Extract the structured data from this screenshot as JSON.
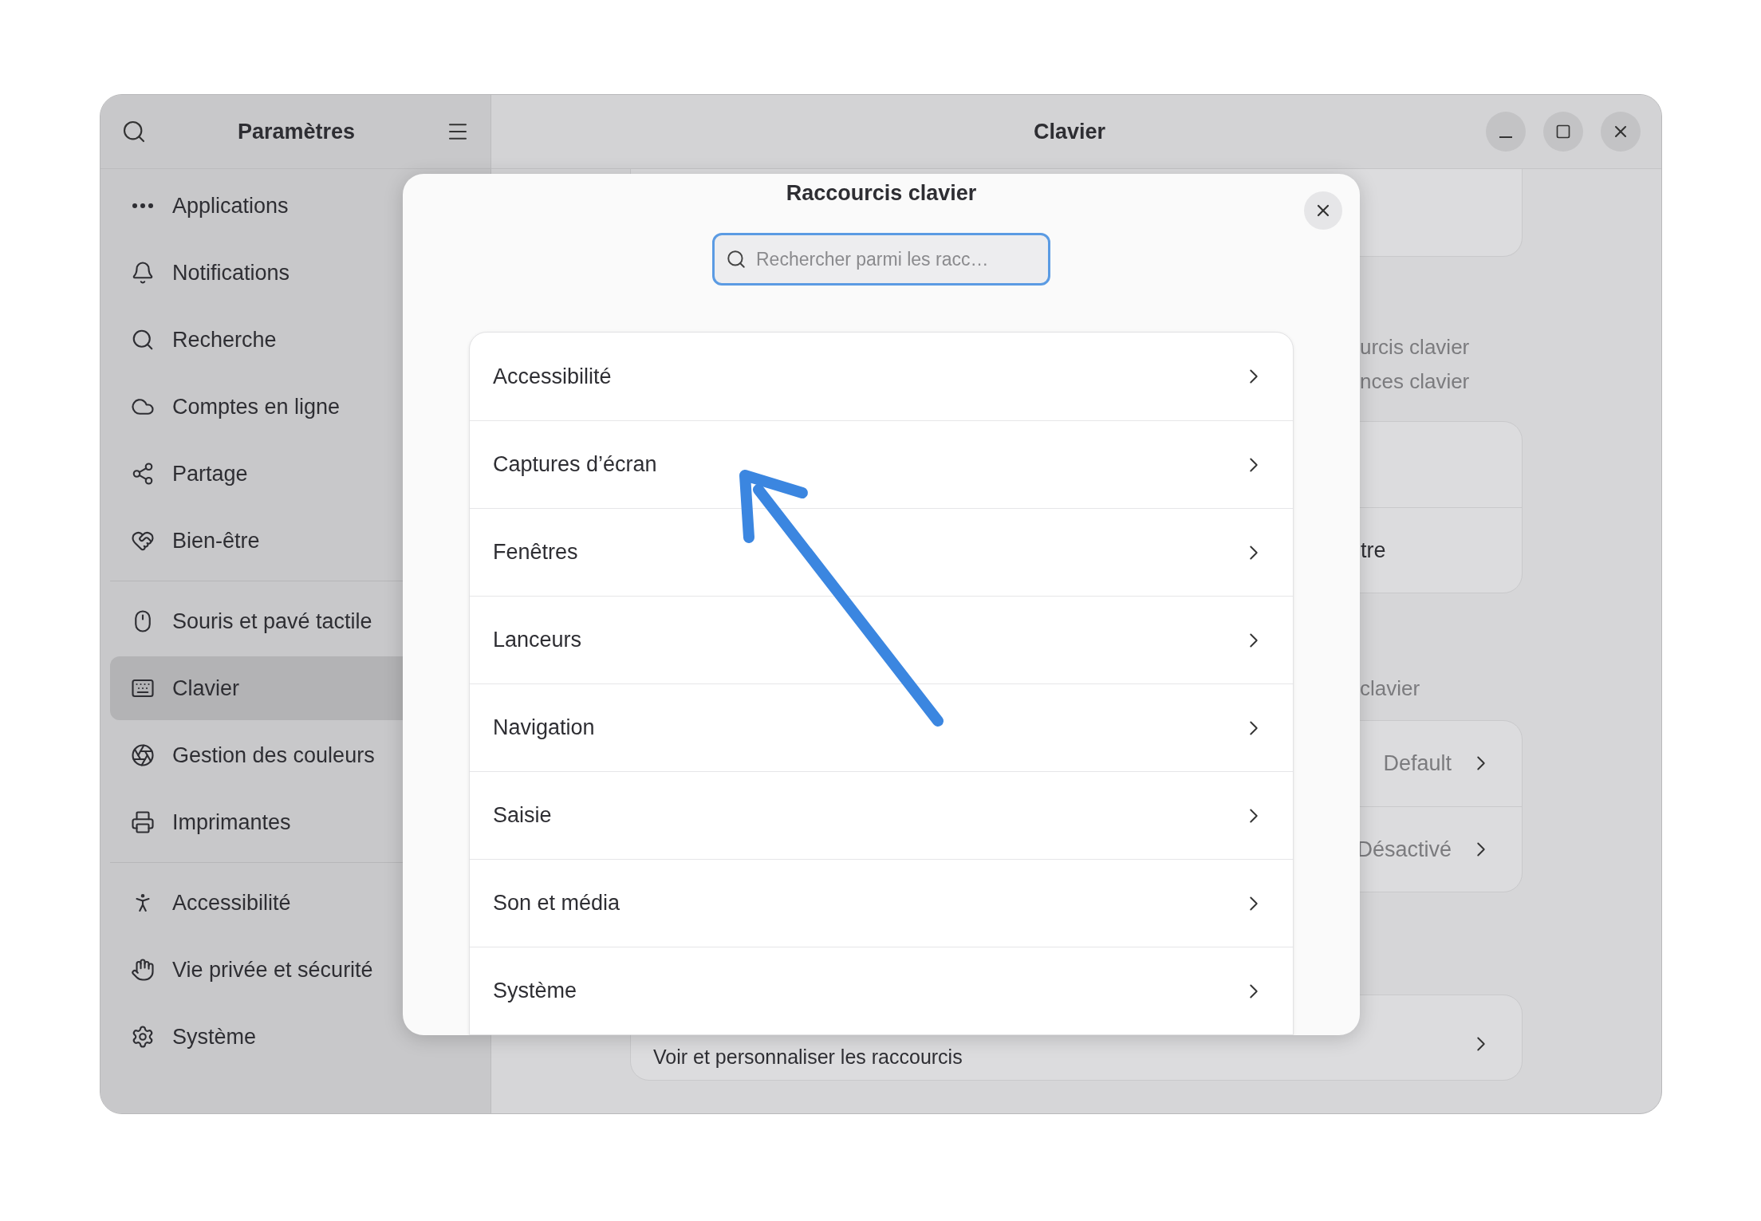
{
  "sidebar": {
    "title": "Paramètres",
    "groups": [
      [
        {
          "label": "Applications",
          "selected": false
        },
        {
          "label": "Notifications",
          "selected": false
        },
        {
          "label": "Recherche",
          "selected": false
        },
        {
          "label": "Comptes en ligne",
          "selected": false
        },
        {
          "label": "Partage",
          "selected": false
        },
        {
          "label": "Bien-être",
          "selected": false
        }
      ],
      [
        {
          "label": "Souris et pavé tactile",
          "selected": false
        },
        {
          "label": "Clavier",
          "selected": true
        },
        {
          "label": "Gestion des couleurs",
          "selected": false
        },
        {
          "label": "Imprimantes",
          "selected": false
        }
      ],
      [
        {
          "label": "Accessibilité",
          "selected": false
        },
        {
          "label": "Vie privée et sécurité",
          "selected": false
        },
        {
          "label": "Système",
          "selected": false
        }
      ]
    ]
  },
  "main": {
    "title": "Clavier",
    "captions": [
      "urcis clavier",
      "nces clavier"
    ],
    "card_row": "tre",
    "heading": "clavier",
    "settings": [
      {
        "value": "Default"
      },
      {
        "value": "Désactivé"
      }
    ],
    "shortcuts_row": "Voir et personnaliser les raccourcis"
  },
  "dialog": {
    "title": "Raccourcis clavier",
    "search": {
      "placeholder": "Rechercher parmi les racc…"
    },
    "categories": [
      {
        "label": "Accessibilité"
      },
      {
        "label": "Captures d’écran"
      },
      {
        "label": "Fenêtres"
      },
      {
        "label": "Lanceurs"
      },
      {
        "label": "Navigation"
      },
      {
        "label": "Saisie"
      },
      {
        "label": "Son et média"
      },
      {
        "label": "Système"
      }
    ]
  }
}
